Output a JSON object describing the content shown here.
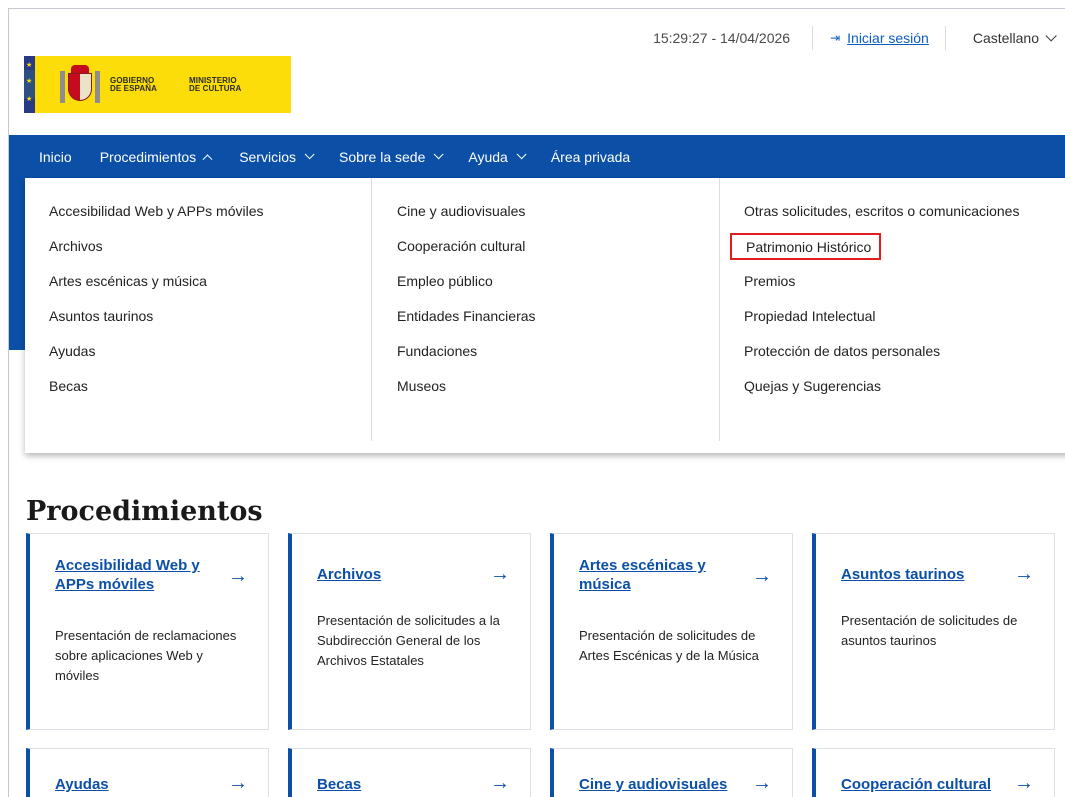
{
  "topbar": {
    "datetime": "15:29:27 - 14/04/2026",
    "login_label": "Iniciar sesión",
    "language": "Castellano"
  },
  "logo": {
    "gobierno": "GOBIERNO DE ESPAÑA",
    "gobierno_l1": "GOBIERNO",
    "gobierno_l2": "DE ESPAÑA",
    "ministerio_l1": "MINISTERIO",
    "ministerio_l2": "DE CULTURA"
  },
  "nav": {
    "items": [
      {
        "label": "Inicio"
      },
      {
        "label": "Procedimientos"
      },
      {
        "label": "Servicios"
      },
      {
        "label": "Sobre la sede"
      },
      {
        "label": "Ayuda"
      },
      {
        "label": "Área privada"
      }
    ]
  },
  "dropdown": {
    "col1": [
      "Accesibilidad Web y APPs móviles",
      "Archivos",
      "Artes escénicas y música",
      "Asuntos taurinos",
      "Ayudas",
      "Becas"
    ],
    "col2": [
      "Cine y audiovisuales",
      "Cooperación cultural",
      "Empleo público",
      "Entidades Financieras",
      "Fundaciones",
      "Museos"
    ],
    "col3": [
      "Otras solicitudes, escritos o comunicaciones",
      "Patrimonio Histórico",
      "Premios",
      "Propiedad Intelectual",
      "Protección de datos personales",
      "Quejas y Sugerencias"
    ],
    "highlighted": "Patrimonio Histórico"
  },
  "procedures": {
    "title": "Procedimientos",
    "cards": [
      {
        "title": "Accesibilidad Web y APPs móviles",
        "desc": "Presentación de reclamaciones sobre aplicaciones Web y móviles"
      },
      {
        "title": "Archivos",
        "desc": "Presentación de solicitudes a la Subdirección General de los Archivos Estatales"
      },
      {
        "title": "Artes escénicas y música",
        "desc": "Presentación de solicitudes de Artes Escénicas y de la Música"
      },
      {
        "title": "Asuntos taurinos",
        "desc": "Presentación de solicitudes de asuntos taurinos"
      },
      {
        "title": "Ayudas",
        "desc": ""
      },
      {
        "title": "Becas",
        "desc": ""
      },
      {
        "title": "Cine y audiovisuales",
        "desc": ""
      },
      {
        "title": "Cooperación cultural",
        "desc": ""
      }
    ],
    "arrow_icon": "→"
  },
  "colors": {
    "primary": "#0b4fa7",
    "logo_yellow": "#fcdd09",
    "highlight_border": "#e11d1d"
  }
}
